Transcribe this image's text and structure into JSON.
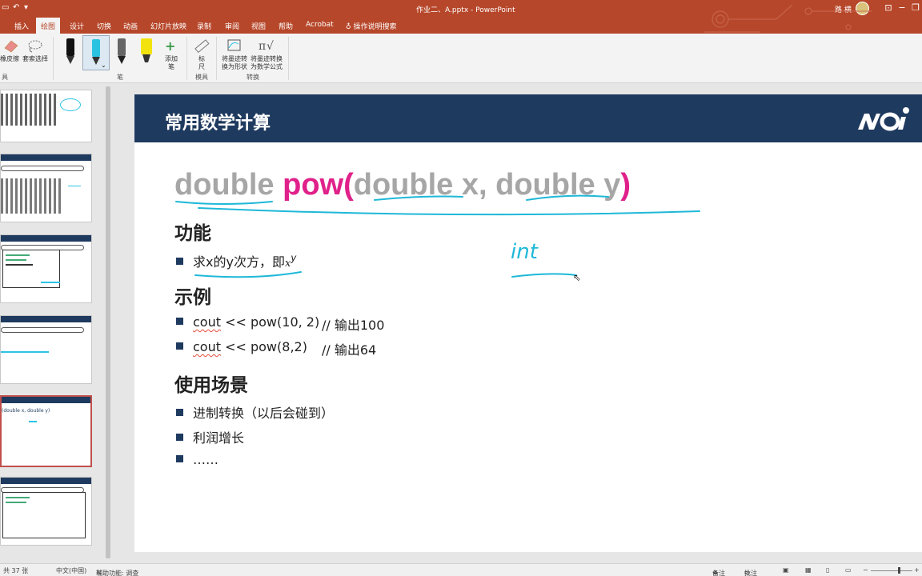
{
  "titlebar": {
    "document_title": "作业二、A.pptx - PowerPoint",
    "user_name": "路 横",
    "qa_icons": [
      "save-icon",
      "undo-icon",
      "customize-icon"
    ]
  },
  "tabs": {
    "items": [
      {
        "label": "插入"
      },
      {
        "label": "绘图",
        "active": true
      },
      {
        "label": "设计"
      },
      {
        "label": "切换"
      },
      {
        "label": "动画"
      },
      {
        "label": "幻灯片放映"
      },
      {
        "label": "录制"
      },
      {
        "label": "审阅"
      },
      {
        "label": "视图"
      },
      {
        "label": "帮助"
      },
      {
        "label": "Acrobat"
      }
    ],
    "tell_me": "操作说明搜索"
  },
  "ribbon": {
    "eraser_label": "橡皮擦",
    "lasso_label": "套索选择",
    "tools_group": "具",
    "pens_group": "笔",
    "add_pen_label": "添加笔",
    "ruler_label": "标尺",
    "stencils_group": "模具",
    "ink_to_shape_label": "将墨迹转换为形状",
    "ink_to_math_label": "将墨迹转换为数学公式",
    "convert_group": "转换"
  },
  "slide": {
    "title": "常用数学计算",
    "signature": {
      "return_type": "double",
      "func_name": "pow(",
      "param1": "double x,",
      "param2": "double y",
      "close": ")"
    },
    "section1_heading": "功能",
    "section1_bullet_text": "求x的y次方，即",
    "section1_bullet_formula": "x",
    "section1_bullet_exp": "y",
    "section2_heading": "示例",
    "example1_code": "cout",
    "example1_rest": " << pow(10, 2)",
    "example1_comment": "// 输出100",
    "example2_code": "cout",
    "example2_rest": " << pow(8,2)",
    "example2_comment": "// 输出64",
    "section3_heading": "使用场景",
    "usage1": "进制转换（以后会碰到）",
    "usage2": "利润增长",
    "usage3": "……",
    "ink_note": "int"
  },
  "status": {
    "slide_count": "共 37 张",
    "language": "中文(中国)",
    "accessibility": "辅助功能: 调查",
    "notes": "备注",
    "comments": "批注"
  },
  "colors": {
    "accent": "#b7472a",
    "slide_header": "#1f3a5f",
    "pink": "#e0218a",
    "ink_cyan": "#1fb8d8"
  }
}
